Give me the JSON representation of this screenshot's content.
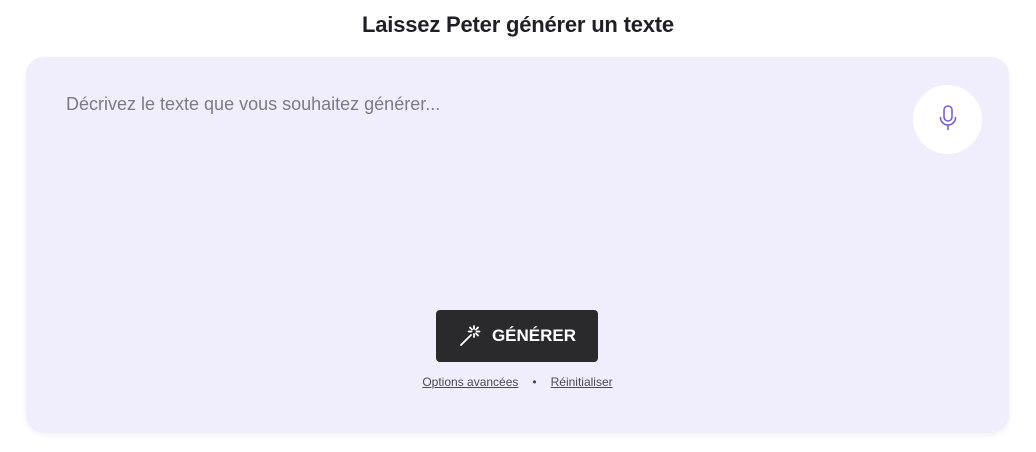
{
  "page": {
    "title": "Laissez Peter générer un texte"
  },
  "prompt": {
    "value": "",
    "placeholder": "Décrivez le texte que vous souhaitez générer..."
  },
  "mic": {
    "icon": "microphone-icon",
    "color": "#7b5cd6"
  },
  "generate": {
    "icon": "magic-wand-icon",
    "label": "GÉNÉRER"
  },
  "links": {
    "advanced_options": "Options avancées",
    "separator": "•",
    "reset": "Réinitialiser"
  },
  "colors": {
    "card_background": "#f0eefc",
    "button_background": "#2a2a2c",
    "title_text": "#1f1f24"
  }
}
